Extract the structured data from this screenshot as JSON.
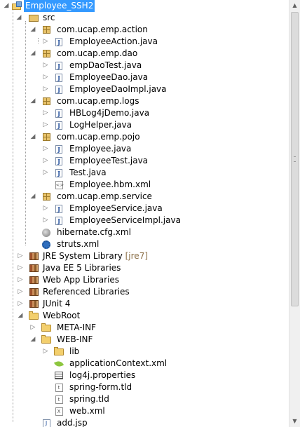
{
  "tree": {
    "project": "Employee_SSH2",
    "src": "src",
    "pkg_action": "com.ucap.emp.action",
    "file_employee_action": "EmployeeAction.java",
    "pkg_dao": "com.ucap.emp.dao",
    "file_empdaotest": "empDaoTest.java",
    "file_employeedao": "EmployeeDao.java",
    "file_employeedaoimpl": "EmployeeDaoImpl.java",
    "pkg_logs": "com.ucap.emp.logs",
    "file_hblog4jdemo": "HBLog4jDemo.java",
    "file_loghelper": "LogHelper.java",
    "pkg_pojo": "com.ucap.emp.pojo",
    "file_employee": "Employee.java",
    "file_employeetest": "EmployeeTest.java",
    "file_test": "Test.java",
    "file_employee_hbm": "Employee.hbm.xml",
    "pkg_service": "com.ucap.emp.service",
    "file_employeeservice": "EmployeeService.java",
    "file_employeeserviceimpl": "EmployeeServiceImpl.java",
    "file_hibernate_cfg": "hibernate.cfg.xml",
    "file_struts": "struts.xml",
    "lib_jre": "JRE System Library",
    "lib_jre_suffix": "[jre7]",
    "lib_javaee": "Java EE 5 Libraries",
    "lib_webapp": "Web App Libraries",
    "lib_referenced": "Referenced Libraries",
    "lib_junit": "JUnit 4",
    "webroot": "WebRoot",
    "meta_inf": "META-INF",
    "web_inf": "WEB-INF",
    "lib_folder": "lib",
    "file_appcontext": "applicationContext.xml",
    "file_log4j": "log4j.properties",
    "file_springform": "spring-form.tld",
    "file_springtld": "spring.tld",
    "file_webxml": "web.xml",
    "file_addjsp": "add.jsp"
  },
  "icons": {
    "project": "java-web-project-icon",
    "source_folder": "source-folder-icon",
    "package": "package-icon",
    "java_file": "java-file-icon",
    "xml_file": "xml-file-icon",
    "library": "library-icon",
    "folder": "folder-icon"
  },
  "colors": {
    "selection": "#3399ff",
    "decoration_text": "#8b6f47"
  }
}
